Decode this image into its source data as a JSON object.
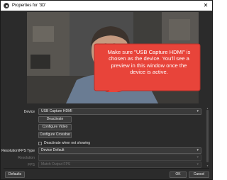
{
  "window": {
    "title": "Properties for '3D'",
    "close_glyph": "✕",
    "app_icon": "obs-icon"
  },
  "callout": {
    "text": "Make sure \"USB Capture HDMI\" is chosen as the device. You'll see a preview in this window once the device is active.",
    "color": "#e8443a"
  },
  "form": {
    "device_label": "Device",
    "device_value": "USB Capture HDMI",
    "deactivate_label": "Deactivate",
    "configure_video_label": "Configure Video",
    "configure_crossbar_label": "Configure Crossbar",
    "deactivate_when_not_showing_label": "Deactivate when not showing",
    "deactivate_when_not_showing_checked": false,
    "resolution_fps_type_label": "Resolution/FPS Type",
    "resolution_fps_type_value": "Device Default",
    "resolution_label": "Resolution",
    "resolution_value": "",
    "fps_label": "FPS",
    "fps_value": "Match Output FPS"
  },
  "footer": {
    "defaults_label": "Defaults",
    "ok_label": "OK",
    "cancel_label": "Cancel"
  }
}
